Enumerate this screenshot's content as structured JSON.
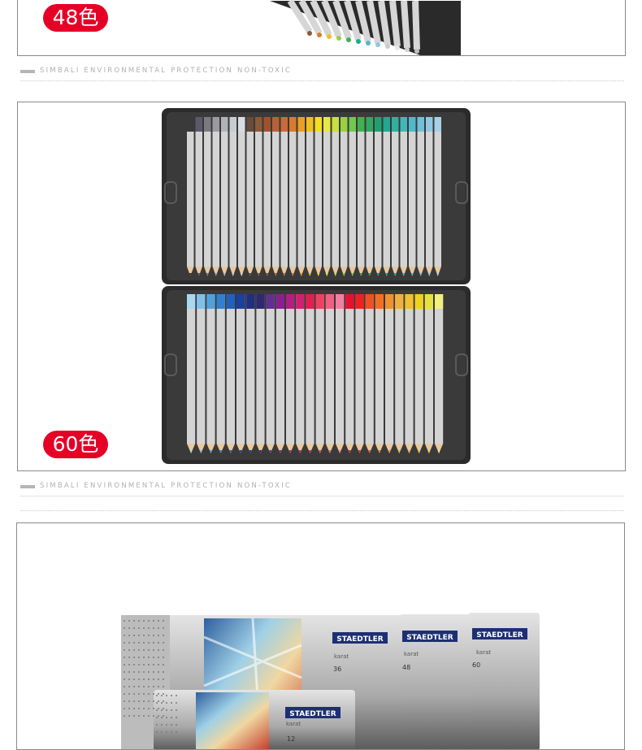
{
  "section_48": {
    "badge": "48色"
  },
  "section_60": {
    "badge": "60色"
  },
  "divider": {
    "text": "SIMBALI ENVIRONMENTAL PROTECTION NON-TOXIC"
  },
  "tins": {
    "brand": "STAEDTLER",
    "product": "karat",
    "counts": [
      "12",
      "36",
      "48",
      "60"
    ]
  },
  "colors": {
    "badge": "#e60026",
    "tray": "#2b2b2b",
    "pencil_body": "#d4d4d4",
    "tin_blue": "#1d2f74"
  }
}
